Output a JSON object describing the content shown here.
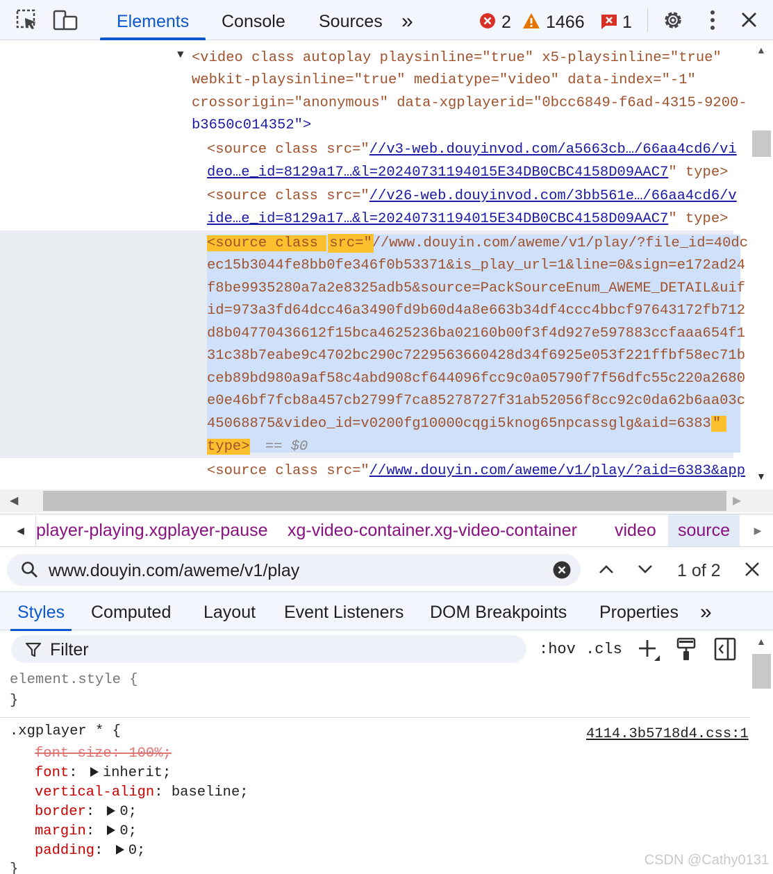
{
  "toolbar": {
    "tabs": [
      {
        "label": "Elements"
      },
      {
        "label": "Console"
      },
      {
        "label": "Sources"
      }
    ],
    "more_tabs": "»",
    "errors": "2",
    "warnings": "1466",
    "issues": "1",
    "accent": "#0b57d0"
  },
  "tree": {
    "video_open": "<video class autoplay playsinline=\"true\" x5-playsinline=\"true\"",
    "video_line2": "webkit-playsinline=\"true\" mediatype=\"video\" data-index=\"-1\"",
    "video_line3": "crossorigin=\"anonymous\" data-xgplayerid=\"0bcc6849-f6ad-4315-9200-",
    "video_line4": "b3650c014352\">",
    "src1_prefix": "<source class src=\"",
    "src1_link_a": "//v3-web.douyinvod.com/a5663cb…/66aa4cd6/vi",
    "src1_link_b": "deo…e_id=8129a17…&l=20240731194015E34DB0CBC4158D09AAC7",
    "src1_suffix": "\" type>",
    "src2_prefix": "<source class src=\"",
    "src2_link_a": "//v26-web.douyinvod.com/3bb561e…/66aa4cd6/v",
    "src2_link_b": "ide…e_id=8129a17…&l=20240731194015E34DB0CBC4158D09AAC7",
    "src2_suffix": "\" type>",
    "sel_open": "<source class ",
    "sel_attr": "src=\"",
    "sel_lines": [
      "//www.douyin.com/aweme/v1/play/?file_id=40dc",
      "ec15b3044fe8bb0fe346f0b53371&is_play_url=1&line=0&sign=e172ad24",
      "f8be9935280a7a2e8325adb5&source=PackSourceEnum_AWEME_DETAIL&uif",
      "id=973a3fd64dcc46a3490fd9b60d4a8e663b34df4ccc4bbcf97643172fb712",
      "d8b04770436612f15bca4625236ba02160b00f3f4d927e597883ccfaaa654f1",
      "31c38b7eabe9c4702bc290c7229563660428d34f6925e053f221ffbf58ec71b",
      "ceb89bd980a9af58c4abd908cf644096fcc9c0a05790f7f56dfc55c220a2680",
      "e0e46bf7fcb8a457cb2799f7ca85278727f31ab52056f8cc92c0da62b6aa03c",
      "45068875&video_id=v0200fg10000cqgi5knog65npcassglg&aid=6383"
    ],
    "sel_close_quote": "\"",
    "sel_type": "type>",
    "sel_eq": "== $0",
    "src4_prefix": "<source class src=\"",
    "src4_link": "//www.douyin.com/aweme/v1/play/?aid=6383&app"
  },
  "breadcrumbs": {
    "items": [
      {
        "label": "player-playing.xgplayer-pause"
      },
      {
        "label": "xg-video-container.xg-video-container"
      },
      {
        "label": "video"
      },
      {
        "label": "source"
      }
    ]
  },
  "search": {
    "value": "www.douyin.com/aweme/v1/play",
    "result": "1 of 2"
  },
  "styles_tabs": {
    "items": [
      {
        "label": "Styles"
      },
      {
        "label": "Computed"
      },
      {
        "label": "Layout"
      },
      {
        "label": "Event Listeners"
      },
      {
        "label": "DOM Breakpoints"
      },
      {
        "label": "Properties"
      }
    ],
    "more": "»"
  },
  "filter": {
    "placeholder": "Filter",
    "hov": ":hov",
    "cls": ".cls"
  },
  "styles": {
    "element_style_open": "element.style {",
    "close_brace": "}",
    "rule_selector": ".xgplayer * {",
    "rule_source": "4114.3b5718d4.css:1",
    "declarations": [
      {
        "prop": "font-size",
        "value": "100%",
        "overridden": true
      },
      {
        "prop": "font",
        "value": "inherit",
        "expandable": true
      },
      {
        "prop": "vertical-align",
        "value": "baseline",
        "expandable": false
      },
      {
        "prop": "border",
        "value": "0",
        "expandable": true
      },
      {
        "prop": "margin",
        "value": "0",
        "expandable": true
      },
      {
        "prop": "padding",
        "value": "0",
        "expandable": true
      }
    ]
  },
  "watermark": "CSDN @Cathy0131"
}
